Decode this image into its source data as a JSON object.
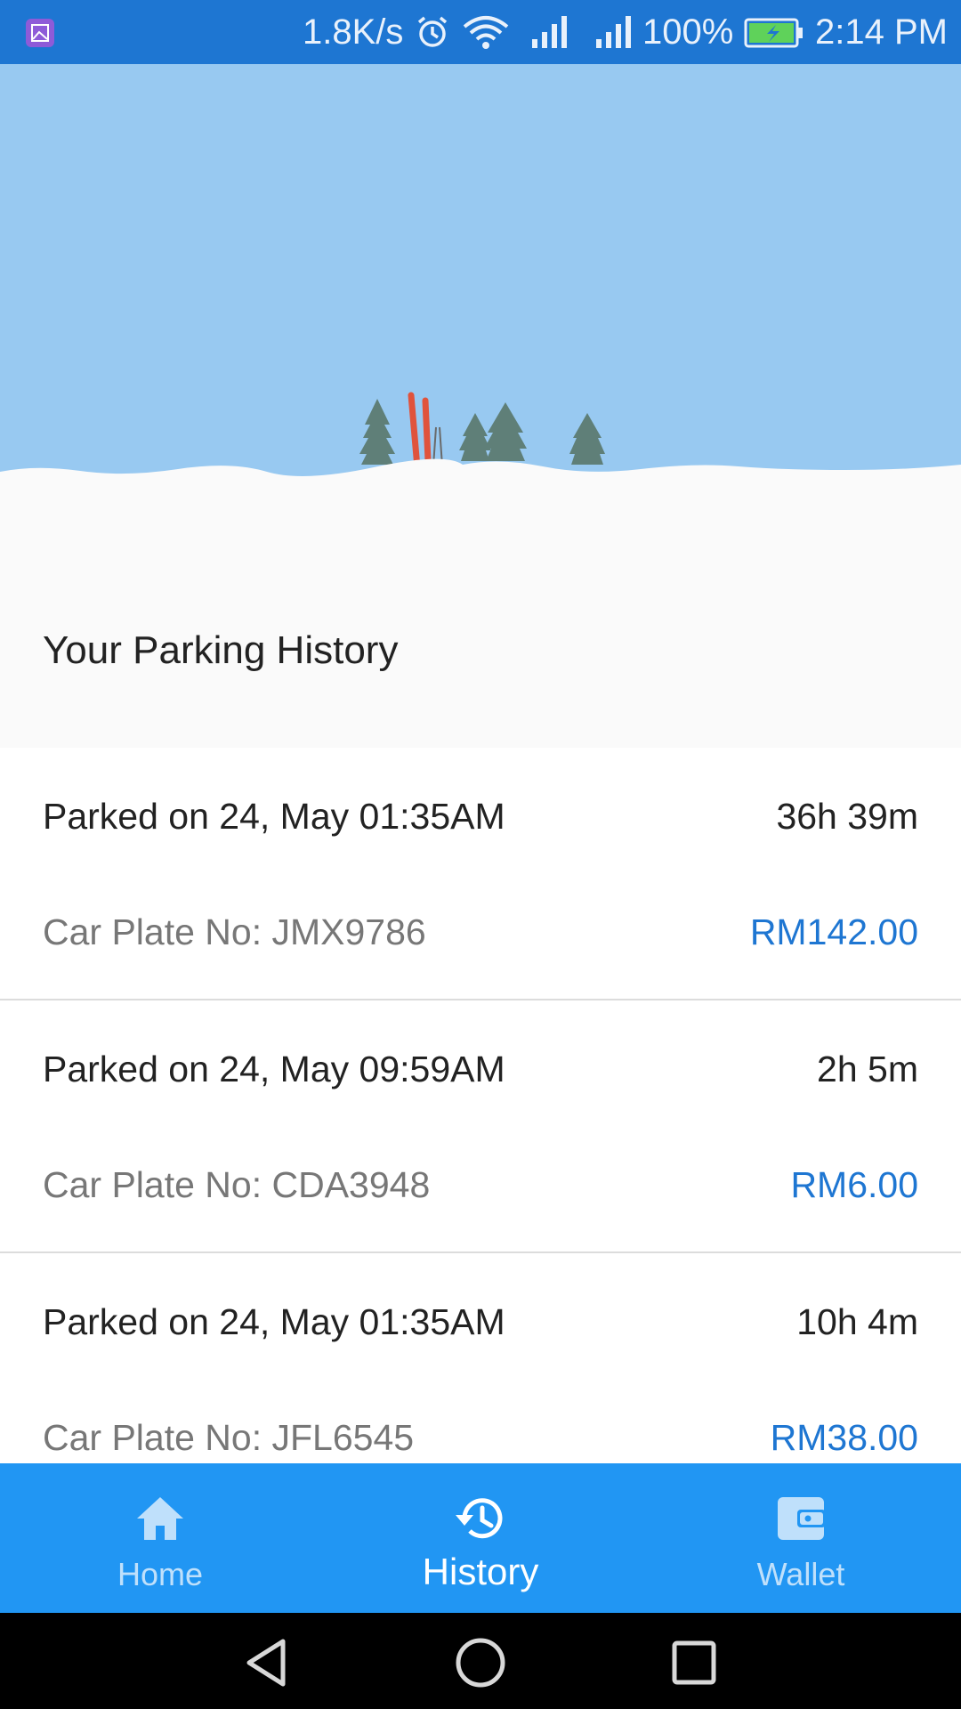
{
  "status_bar": {
    "net_speed": "1.8K/s",
    "battery_percent": "100%",
    "time": "2:14 PM",
    "icons": [
      "gallery-icon",
      "alarm-icon",
      "wifi-icon",
      "signal-icon",
      "signal-icon",
      "battery-charging-icon"
    ]
  },
  "page": {
    "section_title": "Your Parking History"
  },
  "history": [
    {
      "date": "Parked on 24, May 01:35AM",
      "duration": "36h 39m",
      "plate": "Car Plate No: JMX9786",
      "amount": "RM142.00"
    },
    {
      "date": "Parked on 24, May 09:59AM",
      "duration": "2h 5m",
      "plate": "Car Plate No: CDA3948",
      "amount": "RM6.00"
    },
    {
      "date": "Parked on 24, May 01:35AM",
      "duration": "10h 4m",
      "plate": "Car Plate No: JFL6545",
      "amount": "RM38.00"
    }
  ],
  "nav": {
    "home": {
      "label": "Home",
      "icon": "home-icon"
    },
    "history": {
      "label": "History",
      "icon": "history-icon"
    },
    "wallet": {
      "label": "Wallet",
      "icon": "wallet-icon"
    },
    "active": "history"
  },
  "colors": {
    "status_bar": "#1e76d2",
    "sky": "#98c9f1",
    "bottom_nav": "#2196f3",
    "accent": "#1e76d2"
  }
}
